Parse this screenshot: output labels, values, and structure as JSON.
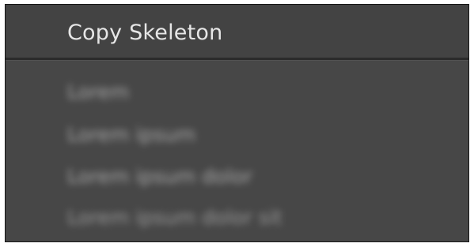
{
  "menu": {
    "title": "Copy Skeleton",
    "items": [
      {
        "label": "Lorem"
      },
      {
        "label": "Lorem ipsum"
      },
      {
        "label": "Lorem ipsum dolor"
      },
      {
        "label": "Lorem ipsum dolor sit"
      }
    ]
  }
}
